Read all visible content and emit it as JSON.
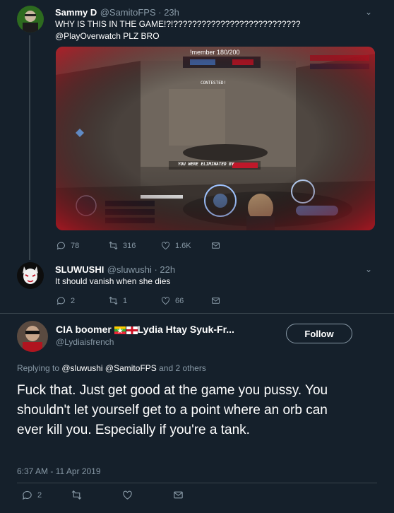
{
  "tweet1": {
    "display_name": "Sammy D",
    "handle_time": "@SamitoFPS · 23h",
    "text_line1": "WHY IS THIS IN THE GAME!?!???????????????????????????",
    "text_line2": "@PlayOverwatch PLZ BRO",
    "media": {
      "video_title": "!member 180/200",
      "eliminated_text": "YOU WERE ELIMINATED BY",
      "contested_text": "CONTESTED!"
    },
    "reply_count": "78",
    "retweet_count": "316",
    "like_count": "1.6K"
  },
  "tweet2": {
    "display_name": "SLUWUSHI",
    "handle_time": "@sluwushi · 22h",
    "text": "It should vanish when she dies",
    "reply_count": "2",
    "retweet_count": "1",
    "like_count": "66"
  },
  "tweet3": {
    "display_name_prefix": "CIA boomer ",
    "display_name_suffix": "Lydia Htay Syuk-Fr...",
    "handle": "@Lydiaisfrench",
    "follow_label": "Follow",
    "replying_prefix": "Replying to ",
    "replying_users": "@sluwushi @SamitoFPS",
    "replying_suffix": " and 2 others",
    "text": "Fuck that. Just get good at the game you pussy. You shouldn't let yourself get to a point where an orb can ever kill you. Especially if you're a tank.",
    "timestamp": "6:37 AM - 11 Apr 2019",
    "reply_count": "2"
  },
  "colors": {
    "background": "#15202b",
    "muted": "#8899a6",
    "divider": "#38444d",
    "game_red": "#c0182a"
  },
  "icons": [
    "reply-icon",
    "retweet-icon",
    "like-icon",
    "share-icon",
    "chevron-down-icon"
  ]
}
